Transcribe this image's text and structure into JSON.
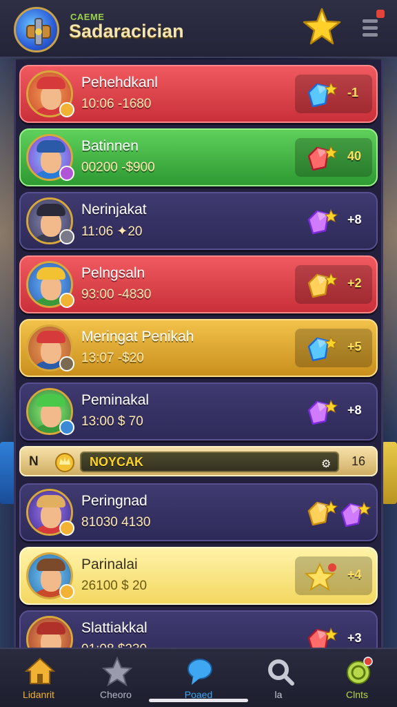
{
  "header": {
    "subtitle": "CAEME",
    "title": "Sadaracician"
  },
  "colors": {
    "red": "#e0444c",
    "green": "#44b546",
    "purple": "#34305f",
    "gold": "#e0aa33",
    "yellow": "#f9e47e",
    "accent_gold": "#ffd42a"
  },
  "cards": [
    {
      "name": "Pehehdkanl",
      "stat": "10:06 -1680",
      "theme": "red",
      "avatar_icon": "red-cap-player-avatar",
      "reward_icon": "blue-gem-icon",
      "reward": "-1"
    },
    {
      "name": "Batinnen",
      "stat": "00200 -$900",
      "theme": "green",
      "avatar_icon": "blue-cap-player-avatar",
      "reward_icon": "red-gem-icon",
      "reward": "40"
    },
    {
      "name": "Nerinjakat",
      "stat": "11:06 ✦20",
      "theme": "purple",
      "avatar_icon": "captain-hat-player-avatar",
      "reward_icon": "purple-gem-icon",
      "reward": "+8"
    },
    {
      "name": "Pelngsaln",
      "stat": "93:00 -4830",
      "theme": "red",
      "avatar_icon": "yellow-helmet-player-avatar",
      "reward_icon": "gold-gem-icon",
      "reward": "+2"
    },
    {
      "name": "Meringat Penikah",
      "stat": "13:07 -$20",
      "theme": "gold",
      "avatar_icon": "pirate-player-avatar",
      "reward_icon": "blue-gem-icon",
      "reward": "+5"
    },
    {
      "name": "Peminakal",
      "stat": "13:00 $ 70",
      "theme": "purple",
      "avatar_icon": "green-crate-avatar",
      "reward_icon": "purple-gem-icon",
      "reward": "+8"
    },
    {
      "name": "Peringnad",
      "stat": "81030 4130",
      "theme": "purple",
      "avatar_icon": "blond-player-avatar",
      "reward_icon": "gold-gem-icon",
      "reward": ""
    },
    {
      "name": "Parinalai",
      "stat": "26100 $ 20",
      "theme": "yellow",
      "avatar_icon": "brown-hair-player-avatar",
      "reward_icon": "star-icon",
      "reward": "+4"
    },
    {
      "name": "Slattiakkal",
      "stat": "01:08 $230",
      "theme": "purple",
      "avatar_icon": "red-hat-player-avatar",
      "reward_icon": "red-gem-icon",
      "reward": "+3"
    }
  ],
  "strip": {
    "left": "N",
    "label": "NOYCAK",
    "count": "16"
  },
  "nav": [
    {
      "label": "Lidanrit",
      "icon": "home-icon",
      "color": "#f2b233"
    },
    {
      "label": "Cheoro",
      "icon": "star-shield-icon",
      "color": "#b6b8c8"
    },
    {
      "label": "Poaed",
      "icon": "chat-bubble-icon",
      "color": "#3fa6f2"
    },
    {
      "label": "la",
      "icon": "search-icon",
      "color": "#c6c8d4"
    },
    {
      "label": "Clnts",
      "icon": "coin-icon",
      "color": "#b6d84a"
    }
  ]
}
